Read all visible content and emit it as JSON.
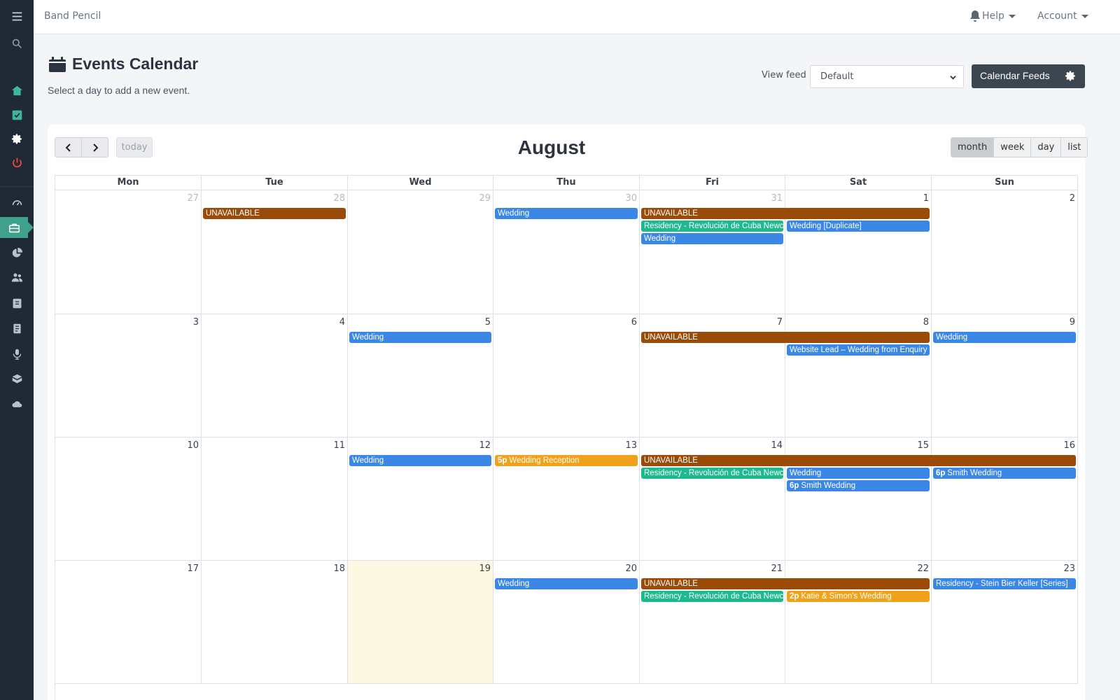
{
  "app": {
    "brand": "Band Pencil"
  },
  "topbar": {
    "help_label": "Help",
    "account_label": "Account"
  },
  "header": {
    "title": "Events Calendar",
    "subtitle": "Select a day to add a new event.",
    "view_feed_label": "View feed",
    "view_feed_value": "Default",
    "calendar_feeds_label": "Calendar Feeds"
  },
  "calendar": {
    "today_label": "today",
    "month_title": "August",
    "views": [
      "month",
      "week",
      "day",
      "list"
    ],
    "active_view": "month",
    "weekdays": [
      "Mon",
      "Tue",
      "Wed",
      "Thu",
      "Fri",
      "Sat",
      "Sun"
    ],
    "weeks": [
      [
        "27",
        "28",
        "29",
        "30",
        "31",
        "1",
        "2"
      ],
      [
        "3",
        "4",
        "5",
        "6",
        "7",
        "8",
        "9"
      ],
      [
        "10",
        "11",
        "12",
        "13",
        "14",
        "15",
        "16"
      ],
      [
        "17",
        "18",
        "19",
        "20",
        "21",
        "22",
        "23"
      ]
    ],
    "events": {
      "w0_unavailable_tue": "UNAVAILABLE",
      "w0_wedding_thu": "Wedding",
      "w0_unavailable_fri_sat": "UNAVAILABLE",
      "w0_residency_fri": "Residency - Revolución de Cuba Newc",
      "w0_wedding_dup_sat": "Wedding [Duplicate]",
      "w0_wedding_fri": "Wedding",
      "w1_wedding_wed": "Wedding",
      "w1_unavailable_fri_sat": "UNAVAILABLE",
      "w1_wedding_sun": "Wedding",
      "w1_website_lead_sat": "Website Lead – Wedding from Enquiry",
      "w2_wedding_wed": "Wedding",
      "w2_reception_thu_time": "5p",
      "w2_reception_thu": "Wedding Reception",
      "w2_unavailable_fri_sun": "UNAVAILABLE",
      "w2_residency_fri": "Residency - Revolución de Cuba Newc",
      "w2_wedding_sat": "Wedding",
      "w2_smith_sun_time": "6p",
      "w2_smith_sun": "Smith Wedding",
      "w2_smith_sat_time": "6p",
      "w2_smith_sat": "Smith Wedding",
      "w3_wedding_thu": "Wedding",
      "w3_unavailable_fri_sat": "UNAVAILABLE",
      "w3_residency_sun": "Residency - Stein Bier Keller [Series]",
      "w3_residency_fri": "Residency - Revolución de Cuba Newc",
      "w3_katie_sat_time": "2p",
      "w3_katie_sat": "Katie & Simon's Wedding"
    }
  },
  "colors": {
    "sidebar_bg": "#1f2a36",
    "accent": "#3fa08c",
    "event_blue": "#3a87e6",
    "event_brown": "#9a4b07",
    "event_green": "#1fb990",
    "event_orange": "#f0a21a",
    "today_bg": "#fcf8e3"
  },
  "icons": {
    "sidebar": [
      "menu-icon",
      "search-icon",
      "home-icon",
      "checkbox-icon",
      "gear-icon",
      "power-icon",
      "dashboard-icon",
      "briefcase-icon",
      "pie-chart-icon",
      "users-icon",
      "contacts-icon",
      "invoice-icon",
      "microphone-icon",
      "box-icon",
      "cloud-icon"
    ]
  }
}
